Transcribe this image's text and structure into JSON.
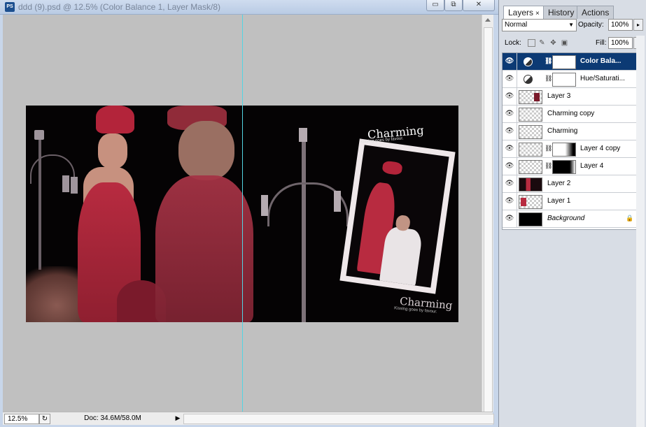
{
  "document": {
    "title": "ddd (9).psd @ 12.5% (Color Balance 1, Layer Mask/8)",
    "app_icon": "PS",
    "window_buttons": {
      "minimize": "▭",
      "restore": "⧉",
      "close": "✕"
    }
  },
  "statusbar": {
    "zoom": "12.5%",
    "doc_size": "Doc: 34.6M/58.0M",
    "menu_arrow": "▶"
  },
  "artwork": {
    "title": "Charming",
    "tagline": "Kissing goes by favour.",
    "title_bottom": "Charming",
    "tagline_bottom": "Kissing goes by favour."
  },
  "panel": {
    "tabs": [
      {
        "label": "Layers",
        "close": "×",
        "active": true
      },
      {
        "label": "History",
        "active": false
      },
      {
        "label": "Actions",
        "active": false
      }
    ],
    "blend_mode": "Normal",
    "opacity_label": "Opacity:",
    "opacity_value": "100%",
    "lock_label": "Lock:",
    "fill_label": "Fill:",
    "fill_value": "100%",
    "flyout": "▸",
    "layers": [
      {
        "name": "Color Bala...",
        "selected": true,
        "visible": true,
        "type": "adjustment"
      },
      {
        "name": "Hue/Saturati...",
        "selected": false,
        "visible": true,
        "type": "adjustment"
      },
      {
        "name": "Layer 3",
        "selected": false,
        "visible": true,
        "type": "pixel"
      },
      {
        "name": "Charming copy",
        "selected": false,
        "visible": true,
        "type": "pixel"
      },
      {
        "name": "Charming",
        "selected": false,
        "visible": true,
        "type": "pixel"
      },
      {
        "name": "Layer 4 copy",
        "selected": false,
        "visible": true,
        "type": "masked"
      },
      {
        "name": "Layer 4",
        "selected": false,
        "visible": true,
        "type": "masked"
      },
      {
        "name": "Layer 2",
        "selected": false,
        "visible": true,
        "type": "pixel"
      },
      {
        "name": "Layer 1",
        "selected": false,
        "visible": true,
        "type": "pixel"
      },
      {
        "name": "Background",
        "selected": false,
        "visible": true,
        "type": "background",
        "locked": true
      }
    ]
  },
  "colors": {
    "selected_layer": "#0c3a74",
    "guide": "#53d4e3",
    "accent_red": "#b8283c"
  }
}
